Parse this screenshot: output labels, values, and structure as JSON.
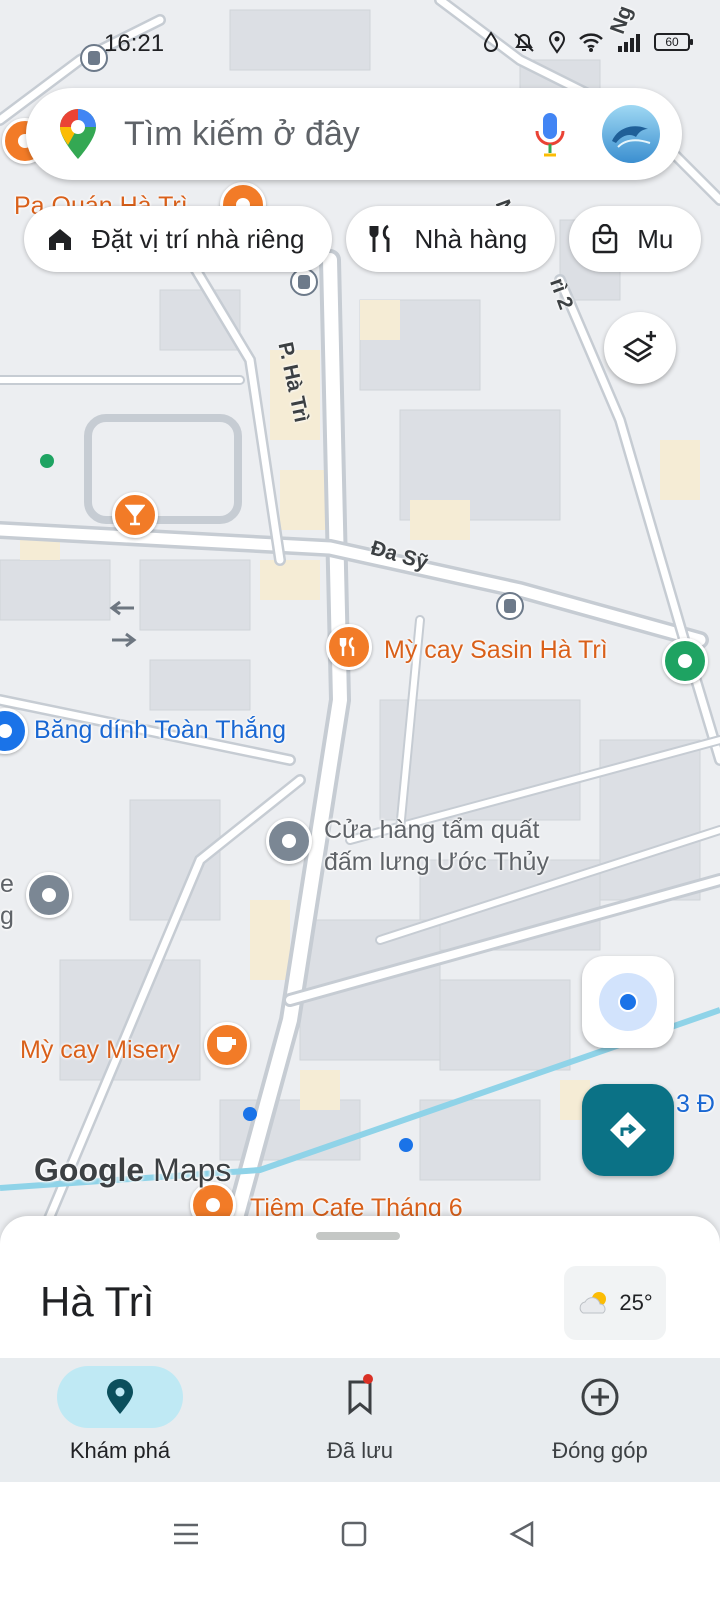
{
  "status_bar": {
    "time": "16:21",
    "battery": "60"
  },
  "search": {
    "placeholder": "Tìm kiếm ở đây"
  },
  "chips": [
    {
      "label": "Đặt vị trí nhà riêng",
      "icon": "home-icon"
    },
    {
      "label": "Nhà hàng",
      "icon": "restaurant-icon"
    },
    {
      "label": "Mu",
      "icon": "shopping-bag-icon"
    }
  ],
  "map": {
    "streets": {
      "ha_tri": "P. Hà Trì",
      "da_sy": "Đa Sỹ",
      "top_right": "Ng",
      "right": "rì 2",
      "right_top": "N"
    },
    "places": {
      "top_left": "Pa   Quán Hà Trì",
      "my_cay_sasin": "Mỳ cay Sasin Hà Trì",
      "bang_dinh": "Băng dính Toàn Thắng",
      "cua_hang_line1": "Cửa hàng tẩm quất",
      "cua_hang_line2": "đấm lưng Ước Thủy",
      "left_edge_1": "e",
      "left_edge_2": "g",
      "my_cay_misery": "Mỳ cay Misery",
      "tiem_cafe": "Tiệm Cafe Tháng 6",
      "right_edge": "3 Đ"
    }
  },
  "branding": {
    "google": "Google",
    "maps": "Maps"
  },
  "sheet": {
    "place_name": "Hà Trì",
    "temperature": "25°"
  },
  "nav": {
    "explore": "Khám phá",
    "saved": "Đã lưu",
    "contribute": "Đóng góp"
  },
  "colors": {
    "accent": "#0b7286",
    "active_tab": "#bfe9f4",
    "poi_orange": "#f27b27",
    "badge": "#d93025"
  }
}
